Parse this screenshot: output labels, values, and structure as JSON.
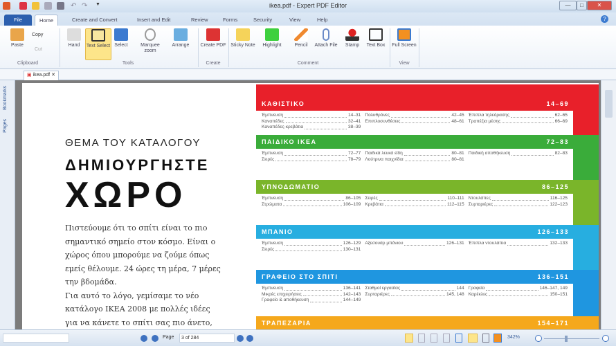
{
  "window": {
    "title": "ikea.pdf - Expert PDF Editor",
    "minimize": "—",
    "maximize": "□",
    "close": "✕"
  },
  "tabs": [
    "File",
    "Home",
    "Create and Convert",
    "Insert and Edit",
    "Review",
    "Forms",
    "Security",
    "View",
    "Help"
  ],
  "ribbon": {
    "clipboard": {
      "paste": "Paste",
      "copy": "Copy",
      "cut": "Cut",
      "group": "Clipboard"
    },
    "tools": {
      "items": [
        "Hand",
        "Text Select",
        "Select",
        "Marquee zoom",
        "Arrange"
      ],
      "group": "Tools"
    },
    "create": {
      "items": [
        "Create PDF"
      ],
      "group": "Create"
    },
    "comment": {
      "items": [
        "Sticky Note",
        "Highlight",
        "Pencil",
        "Attach File",
        "Stamp",
        "Text Box"
      ],
      "group": "Comment"
    },
    "view": {
      "items": [
        "Full Screen"
      ],
      "group": "View"
    }
  },
  "document_tab": "ikea.pdf",
  "side_panel": [
    "Bookmarks",
    "Pages"
  ],
  "page": {
    "kicker": "ΘΕΜΑ ΤΟΥ ΚΑΤΑΛΟΓΟΥ",
    "title1": "ΔΗΜΙΟΥΡΓΗΣΤΕ",
    "title2": "ΧΩΡΟ",
    "body": [
      "Πιστεύουμε ότι το σπίτι είναι το πιο",
      "σημαντικό σημείο στον κόσμο. Είναι ο",
      "χώρος όπου μπορούμε να ζούμε όπως",
      "εμείς θέλουμε. 24 ώρες τη μέρα, 7 μέρες",
      "την βδομάδα.",
      "Για αυτό το λόγο, γεμίσαμε το νέο",
      "κατάλογο ΙΚΕΑ 2008 με πολλές ιδέες",
      "για να κάνετε το σπίτι σας πιο άνετο,"
    ],
    "sections": [
      {
        "title": "ΚΑΘΙΣΤΙΚΟ",
        "pages": "14–69",
        "color": "#e8202a",
        "cols": [
          [
            [
              "Έμπνευση",
              "14–31"
            ],
            [
              "Καναπέδες",
              "32–41"
            ],
            [
              "Καναπέδες-κρεβάτια",
              "38–39"
            ]
          ],
          [
            [
              "Πολυθρόνες",
              "42–45"
            ],
            [
              "Επιπλοσυνθέσεις",
              "48–61"
            ]
          ],
          [
            [
              "Έπιπλα τηλεόρασης",
              "62–65"
            ],
            [
              "Τραπέζια μέσης",
              "66–69"
            ]
          ]
        ]
      },
      {
        "title": "ΠΑΙΔΙΚΟ ΙΚΕΑ",
        "pages": "72–83",
        "color": "#3aac3a",
        "cols": [
          [
            [
              "Έμπνευση",
              "72–77"
            ],
            [
              "Σειρές",
              "78–79"
            ]
          ],
          [
            [
              "Παιδικά λευκά είδη",
              "80–81"
            ],
            [
              "Λούτρινα παιχνίδια",
              "80–81"
            ]
          ],
          [
            [
              "Παιδική αποθήκευση",
              "82–83"
            ]
          ]
        ]
      },
      {
        "title": "ΥΠΝΟΔΩΜΑΤΙΟ",
        "pages": "86–125",
        "color": "#7ab52a",
        "cols": [
          [
            [
              "Έμπνευση",
              "86–105"
            ],
            [
              "Στρώματα",
              "106–109"
            ]
          ],
          [
            [
              "Σειρές",
              "110–111"
            ],
            [
              "Κρεβάτια",
              "112–115"
            ]
          ],
          [
            [
              "Ντουλάπες",
              "116–125"
            ],
            [
              "Συρταριέρες",
              "122–123"
            ]
          ]
        ]
      },
      {
        "title": "ΜΠΑΝΙΟ",
        "pages": "126–133",
        "color": "#27aee0",
        "cols": [
          [
            [
              "Έμπνευση",
              "126–129"
            ],
            [
              "Σειρές",
              "130–131"
            ]
          ],
          [
            [
              "Αξεσουάρ μπάνιου",
              "126–131"
            ]
          ],
          [
            [
              "Έπιπλα ντουλάπια",
              "132–133"
            ]
          ]
        ]
      },
      {
        "title": "ΓΡΑΦΕΙΟ ΣΤΟ ΣΠΙΤΙ",
        "pages": "136–151",
        "color": "#1f96e0",
        "cols": [
          [
            [
              "Έμπνευση",
              "136–141"
            ],
            [
              "Μικρές επιχειρήσεις",
              "142–143"
            ],
            [
              "Γραφείο & αποθήκευση",
              "144–149"
            ]
          ],
          [
            [
              "Σταθμοί εργασίας",
              "144"
            ],
            [
              "Συρταριέρες",
              "145, 148"
            ]
          ],
          [
            [
              "Γραφεία",
              "146–147, 149"
            ],
            [
              "Καρέκλες",
              "150–151"
            ]
          ]
        ]
      },
      {
        "title": "ΤΡΑΠΕΖΑΡΙΑ",
        "pages": "154–171",
        "color": "#f5a81c",
        "cols": []
      }
    ]
  },
  "status": {
    "page_label": "Page",
    "page_value": "3 of 284",
    "zoom": "342%"
  }
}
